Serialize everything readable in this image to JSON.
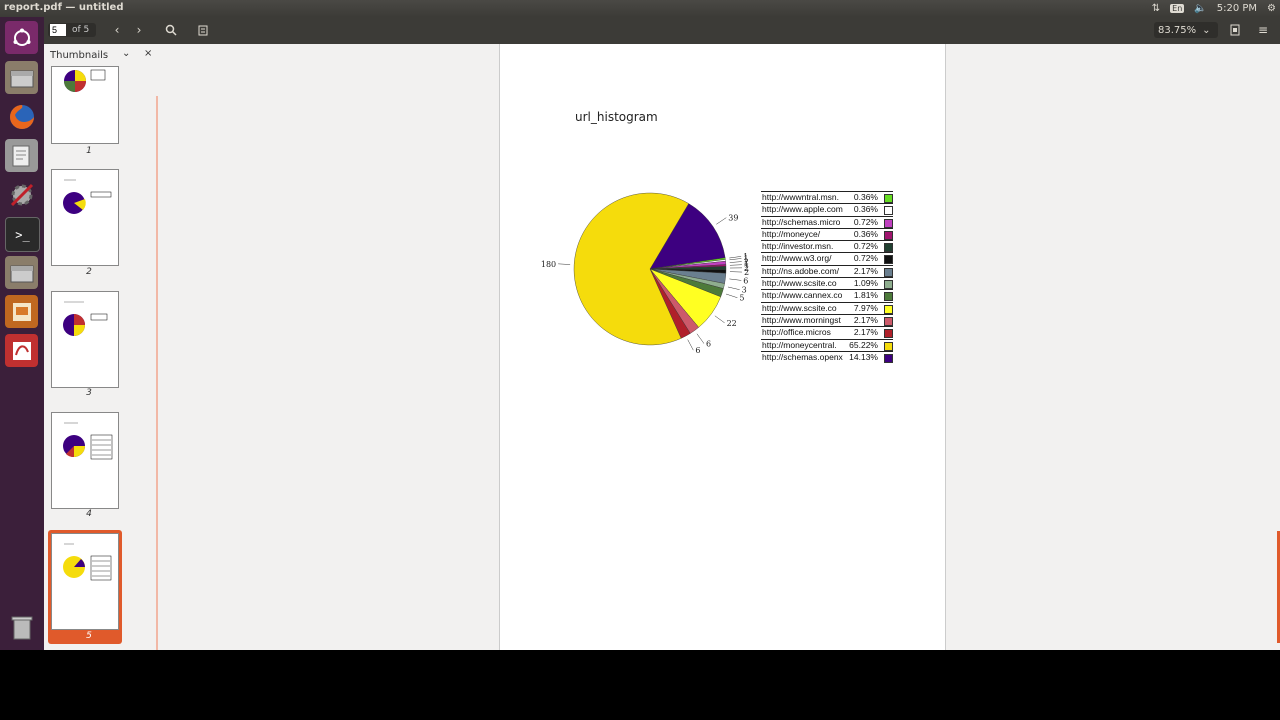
{
  "window": {
    "title": "report.pdf — untitled"
  },
  "tray": {
    "keyboard": "En",
    "time": "5:20 PM"
  },
  "toolbar": {
    "page_current": "5",
    "page_total": "of 5",
    "zoom": "83.75%"
  },
  "sidebar": {
    "title": "Thumbnails",
    "thumbnails": [
      "1",
      "2",
      "3",
      "4",
      "5"
    ],
    "selected": "5"
  },
  "launcher": {
    "items": [
      "ubuntu-dash",
      "files",
      "firefox",
      "text-editor",
      "system-settings",
      "terminal",
      "files",
      "impress",
      "document-viewer",
      "trash"
    ]
  },
  "colors": {
    "yellow": "#f5dc0c",
    "purple": "#3d0080",
    "accent": "#e05a2b"
  },
  "chart_data": {
    "type": "pie",
    "title": "url_histogram",
    "slice_labels": [
      "180",
      "39",
      "1",
      "1",
      "2",
      "1",
      "2",
      "2",
      "6",
      "3",
      "5",
      "22",
      "6",
      "6"
    ],
    "legend": [
      {
        "label": "http://wwwntral.msn.",
        "pct": "0.36%",
        "color": "#66dd22"
      },
      {
        "label": "http://www.apple.com",
        "pct": "0.36%",
        "color": "#ffffff"
      },
      {
        "label": "http://schemas.micro",
        "pct": "0.72%",
        "color": "#c040c0"
      },
      {
        "label": "http://moneyce/",
        "pct": "0.36%",
        "color": "#a0146e"
      },
      {
        "label": "http://investor.msn.",
        "pct": "0.72%",
        "color": "#204030"
      },
      {
        "label": "http://www.w3.org/",
        "pct": "0.72%",
        "color": "#111111"
      },
      {
        "label": "http://ns.adobe.com/",
        "pct": "2.17%",
        "color": "#6a7f8f"
      },
      {
        "label": "http://www.scsite.co",
        "pct": "1.09%",
        "color": "#8fae8f"
      },
      {
        "label": "http://www.cannex.co",
        "pct": "1.81%",
        "color": "#4d7a3a"
      },
      {
        "label": "http://www.scsite.co",
        "pct": "7.97%",
        "color": "#ffff22"
      },
      {
        "label": "http://www.morningst",
        "pct": "2.17%",
        "color": "#cc5a6a"
      },
      {
        "label": "http://office.micros",
        "pct": "2.17%",
        "color": "#b0202a"
      },
      {
        "label": "http://moneycentral.",
        "pct": "65.22%",
        "color": "#f5dc0c"
      },
      {
        "label": "http://schemas.openx",
        "pct": "14.13%",
        "color": "#3d0080"
      }
    ],
    "values": [
      1,
      1,
      2,
      1,
      2,
      2,
      6,
      3,
      5,
      22,
      6,
      6,
      180,
      39
    ]
  }
}
